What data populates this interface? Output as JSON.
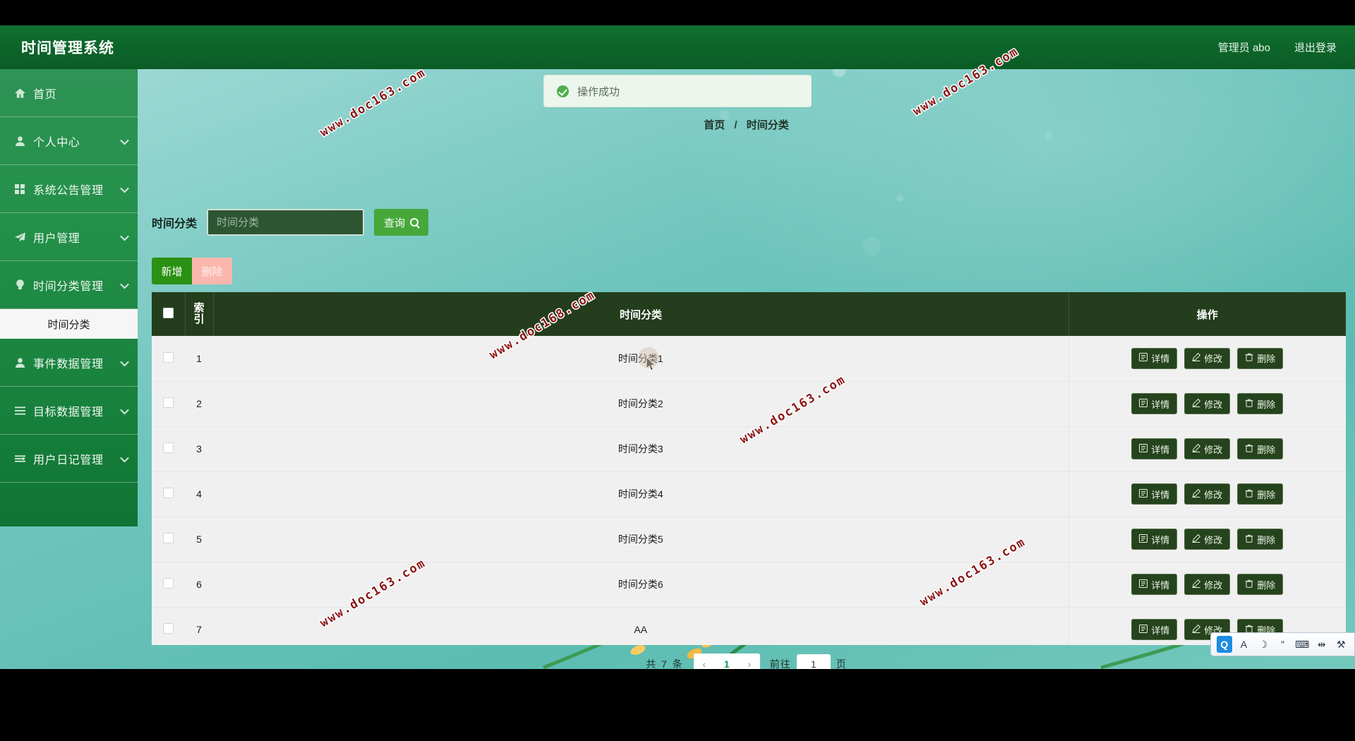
{
  "header": {
    "title": "时间管理系统",
    "role_label": "管理员",
    "username": "abo",
    "logout_label": "退出登录"
  },
  "toast": {
    "message": "操作成功",
    "icon": "check-circle-icon",
    "color": "#4caf50"
  },
  "sidebar": {
    "items": [
      {
        "label": "首页",
        "icon": "home-icon",
        "has_children": false
      },
      {
        "label": "个人中心",
        "icon": "user-icon",
        "has_children": true
      },
      {
        "label": "系统公告管理",
        "icon": "grid-icon",
        "has_children": true
      },
      {
        "label": "用户管理",
        "icon": "send-icon",
        "has_children": true
      },
      {
        "label": "时间分类管理",
        "icon": "bulb-icon",
        "has_children": true
      },
      {
        "label": "事件数据管理",
        "icon": "person-icon",
        "has_children": true
      },
      {
        "label": "目标数据管理",
        "icon": "list-icon",
        "has_children": true
      },
      {
        "label": "用户日记管理",
        "icon": "sliders-icon",
        "has_children": true
      }
    ],
    "submenu": {
      "label": "时间分类",
      "parent_index": 4,
      "active": true
    }
  },
  "breadcrumb": {
    "home": "首页",
    "separator": "/",
    "current": "时间分类"
  },
  "search": {
    "label": "时间分类",
    "placeholder": "时间分类",
    "value": "",
    "button_label": "查询",
    "button_icon": "search-icon"
  },
  "toolbar": {
    "add_label": "新增",
    "delete_label": "删除"
  },
  "table": {
    "columns": [
      "",
      "索引",
      "时间分类",
      "操作"
    ],
    "index_header_lines": [
      "索",
      "引"
    ],
    "rows": [
      {
        "index": "1",
        "name": "时间分类1"
      },
      {
        "index": "2",
        "name": "时间分类2"
      },
      {
        "index": "3",
        "name": "时间分类3"
      },
      {
        "index": "4",
        "name": "时间分类4"
      },
      {
        "index": "5",
        "name": "时间分类5"
      },
      {
        "index": "6",
        "name": "时间分类6"
      },
      {
        "index": "7",
        "name": "AA"
      }
    ],
    "ops": {
      "detail_label": "详情",
      "edit_label": "修改",
      "delete_label": "删除",
      "detail_icon": "document-icon",
      "edit_icon": "pencil-icon",
      "delete_icon": "trash-icon"
    }
  },
  "pagination": {
    "total_prefix": "共",
    "total_count": "7",
    "total_suffix": "条",
    "prev_icon": "chevron-left-icon",
    "next_icon": "chevron-right-icon",
    "current_page": "1",
    "jump_prefix": "前往",
    "jump_value": "1",
    "jump_suffix": "页"
  },
  "watermarks": [
    {
      "text": "www.doc163.com"
    },
    {
      "text": "www.doc163.com"
    },
    {
      "text": "www.doc168.com"
    },
    {
      "text": "www.doc163.com"
    },
    {
      "text": "www.doc163.com"
    },
    {
      "text": "www.doc163.com"
    }
  ],
  "ime": {
    "items": [
      {
        "icon": "qq-logo-icon",
        "glyph": "Q",
        "active": true
      },
      {
        "icon": "language-icon",
        "glyph": "A",
        "active": false
      },
      {
        "icon": "moon-icon",
        "glyph": "☽",
        "active": false
      },
      {
        "icon": "punctuation-icon",
        "glyph": "''",
        "active": false
      },
      {
        "icon": "keyboard-icon",
        "glyph": "⌨",
        "active": false
      },
      {
        "icon": "toolbox-icon",
        "glyph": "⇹",
        "active": false
      },
      {
        "icon": "wrench-icon",
        "glyph": "⚒",
        "active": false
      }
    ]
  },
  "theme": {
    "header_green": "#0c6329",
    "sidebar_green": "#1e8c45",
    "table_header_dark": "#243d1c",
    "primary_green": "#46a83a",
    "danger_pink": "#fbb7ae",
    "bg_teal": "#6ec5bd"
  }
}
